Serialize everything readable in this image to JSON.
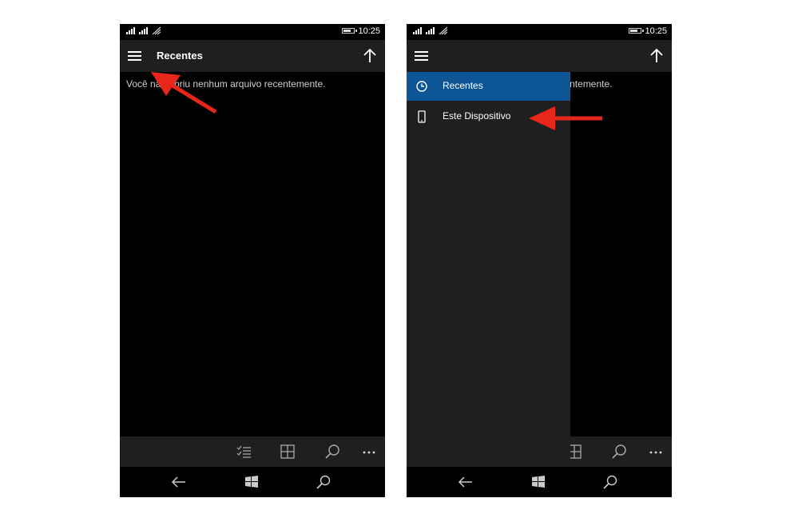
{
  "colors": {
    "accent": "#0e5596",
    "annotation": "#e8261a",
    "bar": "#1f1f1f",
    "background": "#000000"
  },
  "left_phone": {
    "status": {
      "time": "10:25"
    },
    "app_bar": {
      "title": "Recentes",
      "menu_icon": "hamburger-icon",
      "up_icon": "up-arrow-icon"
    },
    "empty_message": "Você não abriu nenhum arquivo recentemente.",
    "command_bar": [
      "checklist-icon",
      "grid-icon",
      "search-icon",
      "more-icon"
    ],
    "nav_bar": [
      "back-icon",
      "windows-icon",
      "search-icon"
    ]
  },
  "right_phone": {
    "status": {
      "time": "10:25"
    },
    "background_message": "Você não abriu nenhum arquivo recentemente.",
    "drawer": {
      "items": [
        {
          "label": "Recentes",
          "icon": "clock-icon",
          "selected": true
        },
        {
          "label": "Este Dispositivo",
          "icon": "phone-icon",
          "selected": false
        }
      ]
    }
  }
}
